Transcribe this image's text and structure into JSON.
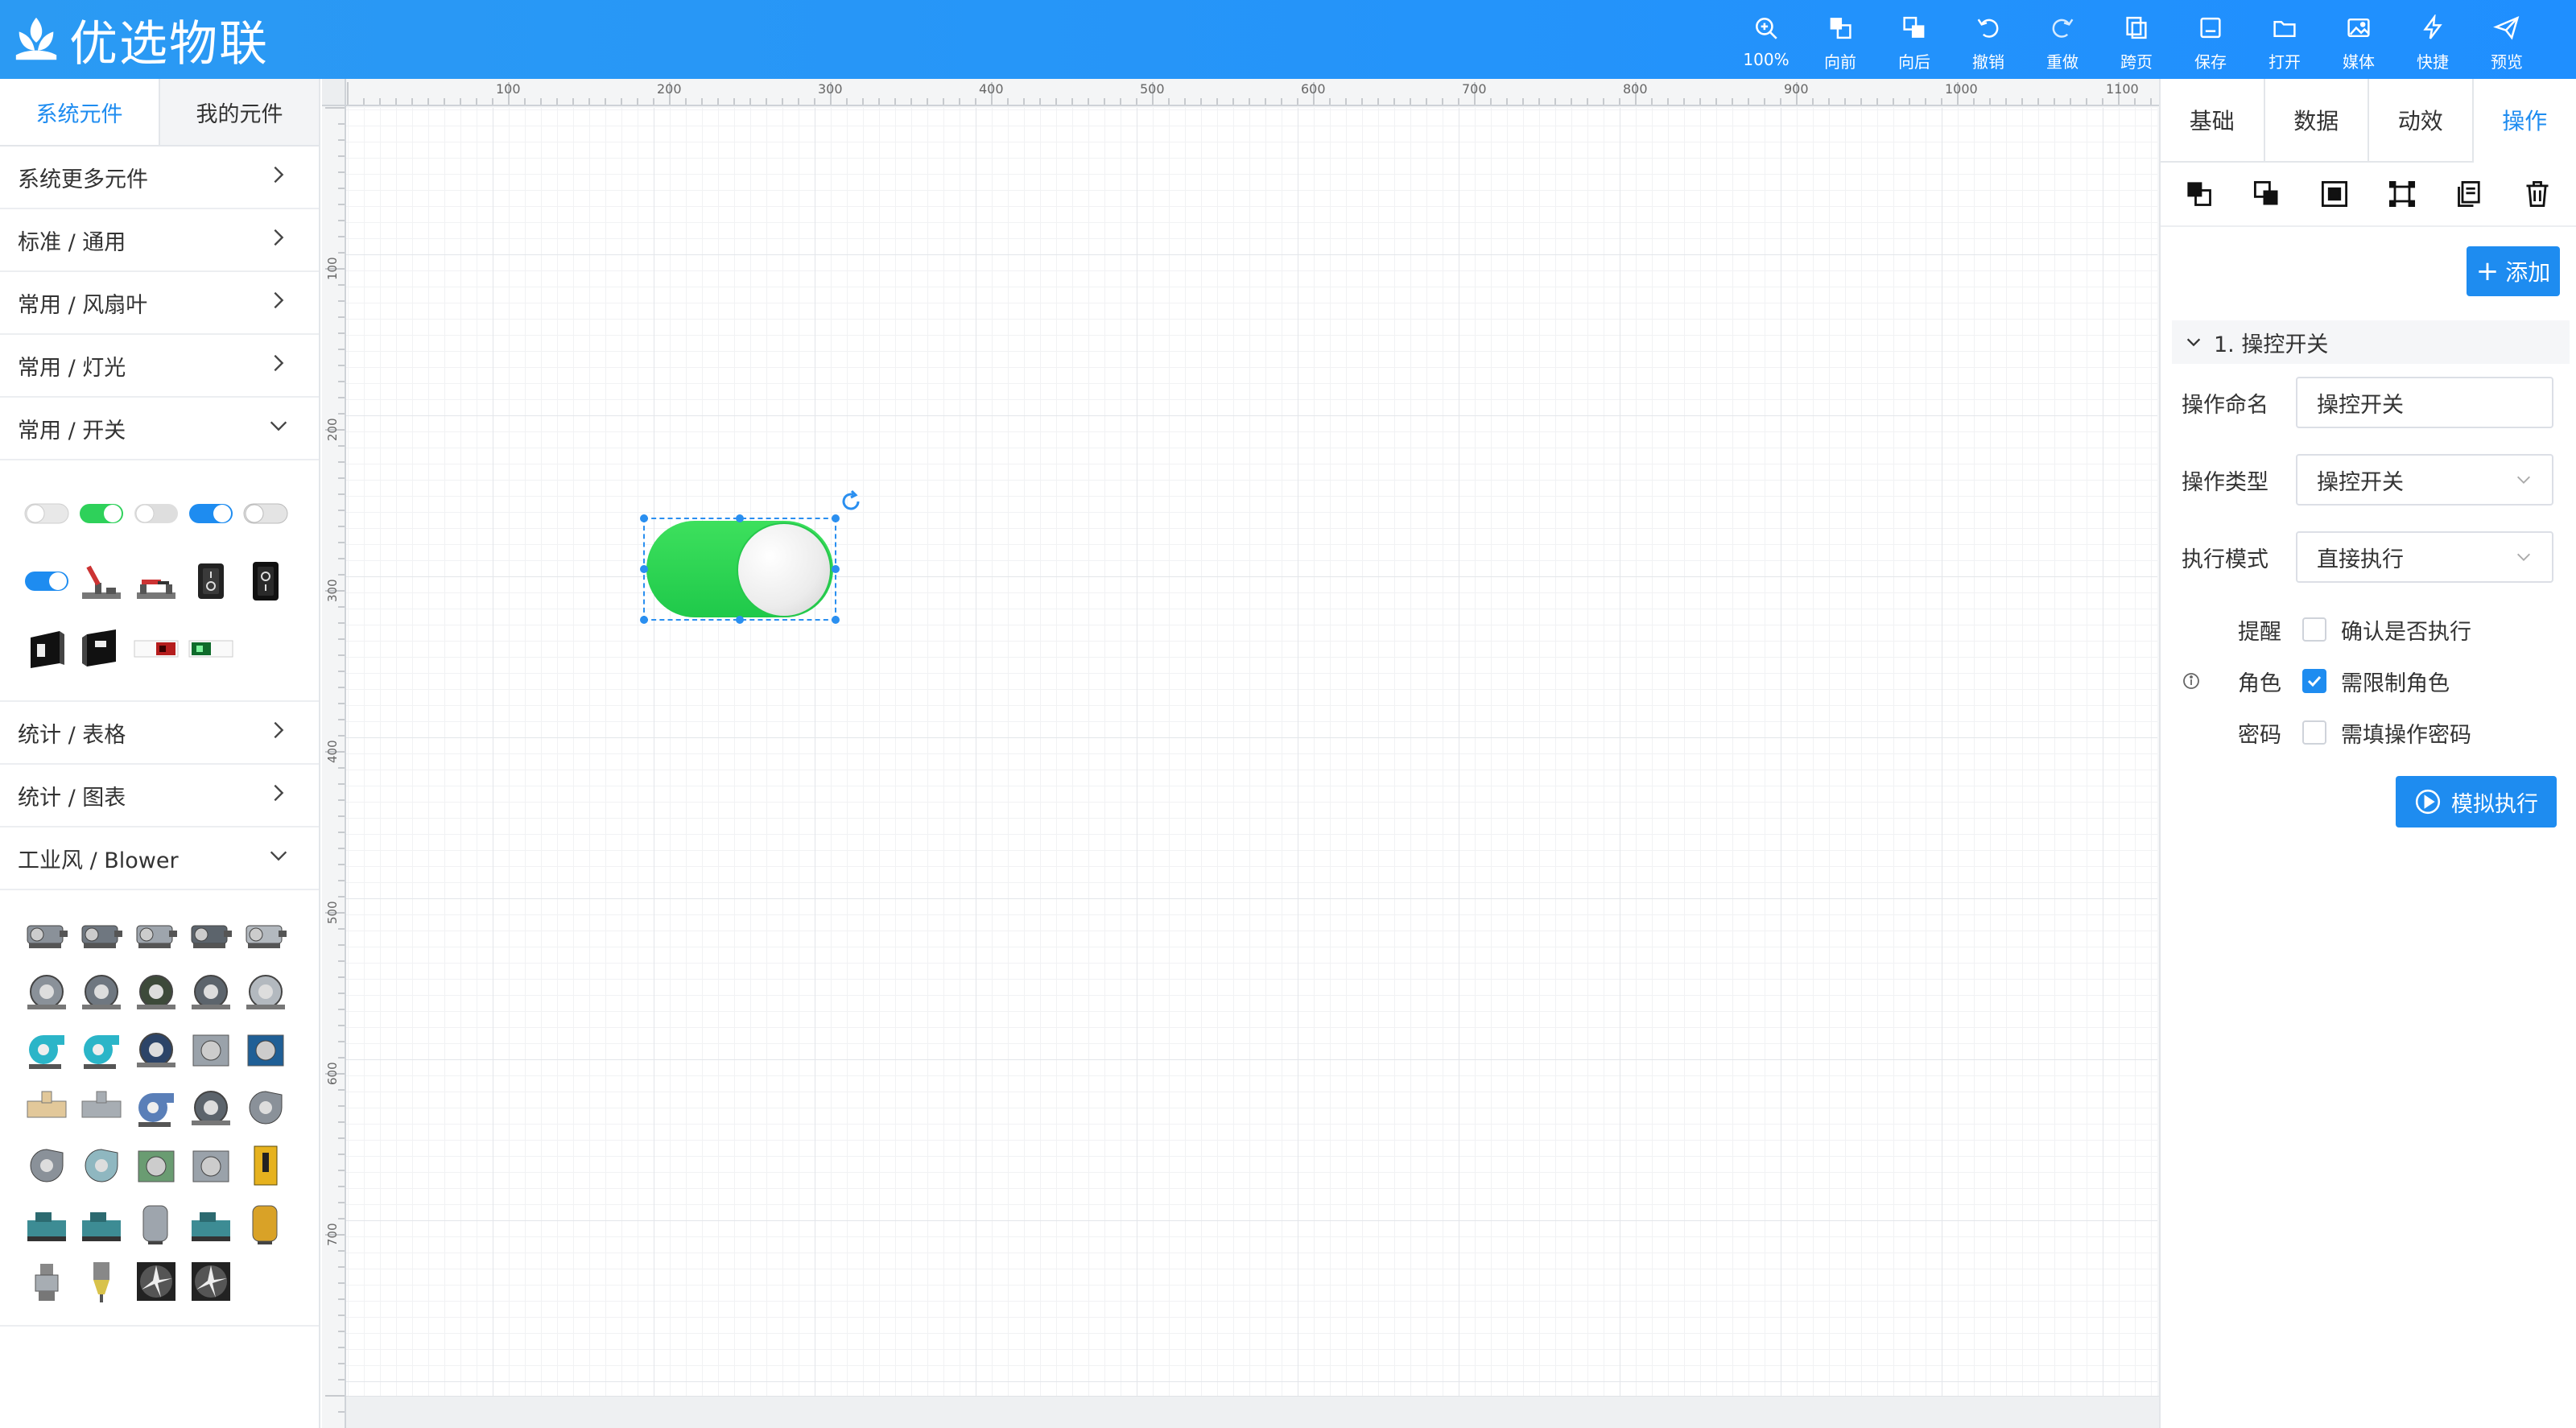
{
  "app": {
    "title": "优选物联"
  },
  "toolbar": {
    "zoom": "100%",
    "forward": "向前",
    "backward": "向后",
    "undo": "撤销",
    "redo": "重做",
    "cross_page": "跨页",
    "save": "保存",
    "open": "打开",
    "media": "媒体",
    "shortcut": "快捷",
    "preview": "预览"
  },
  "left_panel": {
    "tabs": [
      "系统元件",
      "我的元件"
    ],
    "active_tab": "系统元件",
    "categories": [
      {
        "label": "系统更多元件",
        "expanded": false
      },
      {
        "label": "标准 / 通用",
        "expanded": false
      },
      {
        "label": "常用 / 风扇叶",
        "expanded": false
      },
      {
        "label": "常用 / 灯光",
        "expanded": false
      },
      {
        "label": "常用 / 开关",
        "expanded": true
      },
      {
        "label": "统计 / 表格",
        "expanded": false
      },
      {
        "label": "统计 / 图表",
        "expanded": false
      },
      {
        "label": "工业风 / Blower",
        "expanded": true
      }
    ]
  },
  "canvas": {
    "ruler_top": [
      "100",
      "200",
      "300",
      "400",
      "500",
      "600",
      "700",
      "800",
      "900",
      "1000",
      "1100"
    ],
    "ruler_left": [
      "100",
      "200",
      "300",
      "400",
      "500",
      "600",
      "700"
    ]
  },
  "right_panel": {
    "tabs": [
      "基础",
      "数据",
      "动效",
      "操作"
    ],
    "active_tab": "操作",
    "add_button": "添加",
    "operation": {
      "section_title": "1. 操控开关",
      "name_label": "操作命名",
      "name_value": "操控开关",
      "type_label": "操作类型",
      "type_value": "操控开关",
      "mode_label": "执行模式",
      "mode_value": "直接执行",
      "remind_label": "提醒",
      "remind_text": "确认是否执行",
      "remind_checked": false,
      "role_label": "角色",
      "role_text": "需限制角色",
      "role_checked": true,
      "password_label": "密码",
      "password_text": "需填操作密码",
      "password_checked": false,
      "simulate_button": "模拟执行"
    }
  },
  "colors": {
    "primary": "#1e8cf0",
    "header_bg": "#2b9af3",
    "switch_on": "#2ed15a"
  }
}
